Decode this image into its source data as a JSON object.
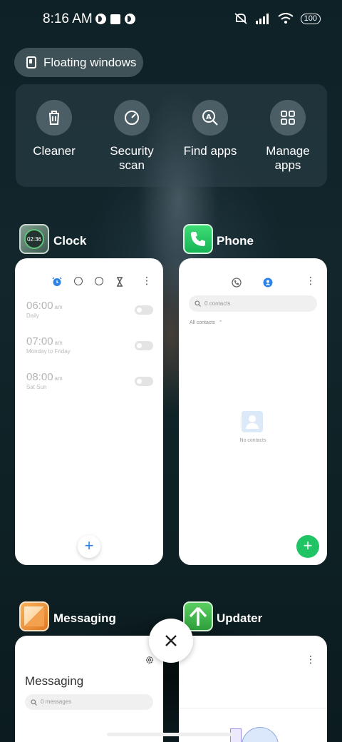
{
  "status_bar": {
    "time": "8:16 AM",
    "battery": "100"
  },
  "floating_windows": {
    "label": "Floating windows"
  },
  "tools": [
    {
      "label": "Cleaner",
      "icon": "trash-icon"
    },
    {
      "label": "Security\nscan",
      "icon": "security-scan-icon"
    },
    {
      "label": "Find apps",
      "icon": "find-apps-icon"
    },
    {
      "label": "Manage\napps",
      "icon": "manage-apps-icon"
    }
  ],
  "apps": {
    "clock": {
      "name": "Clock",
      "icon_time": "02:36",
      "alarms": [
        {
          "time": "06:00",
          "ampm": "am",
          "repeat": "Daily"
        },
        {
          "time": "07:00",
          "ampm": "am",
          "repeat": "Monday to Friday"
        },
        {
          "time": "08:00",
          "ampm": "am",
          "repeat": "Sat Sun"
        }
      ],
      "fab": "+"
    },
    "phone": {
      "name": "Phone",
      "search_placeholder": "0 contacts",
      "filter_label": "All contacts",
      "empty_text": "No contacts",
      "fab": "+"
    },
    "messaging": {
      "name": "Messaging",
      "title": "Messaging",
      "search_placeholder": "0 messages"
    },
    "updater": {
      "name": "Updater"
    }
  },
  "colors": {
    "accent_blue": "#2c82e6",
    "phone_green": "#20c465",
    "updater_green": "#3bb54a",
    "messaging_orange": "#f19a3a"
  }
}
